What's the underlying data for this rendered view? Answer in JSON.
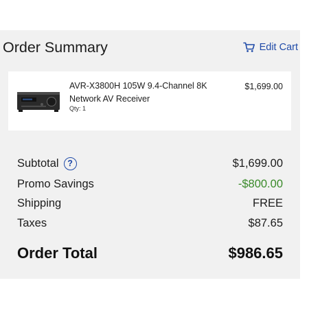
{
  "header": {
    "title": "Order Summary",
    "edit_cart_label": "Edit Cart",
    "edit_cart_icon": "cart-icon",
    "accent_color": "#1f4aa8"
  },
  "item": {
    "name": "AVR-X3800H 105W 9.4-Channel 8K Network AV Receiver",
    "qty": "Qty: 1",
    "price": "$1,699.00",
    "image": "av-receiver-image"
  },
  "summary": {
    "subtotal_label": "Subtotal",
    "subtotal_help_icon": "?",
    "subtotal_value": "$1,699.00",
    "promo_label": "Promo Savings",
    "promo_value": "-$800.00",
    "promo_color": "#3a8a2a",
    "shipping_label": "Shipping",
    "shipping_value": "FREE",
    "taxes_label": "Taxes",
    "taxes_value": "$87.65",
    "total_label": "Order Total",
    "total_value": "$986.65"
  }
}
